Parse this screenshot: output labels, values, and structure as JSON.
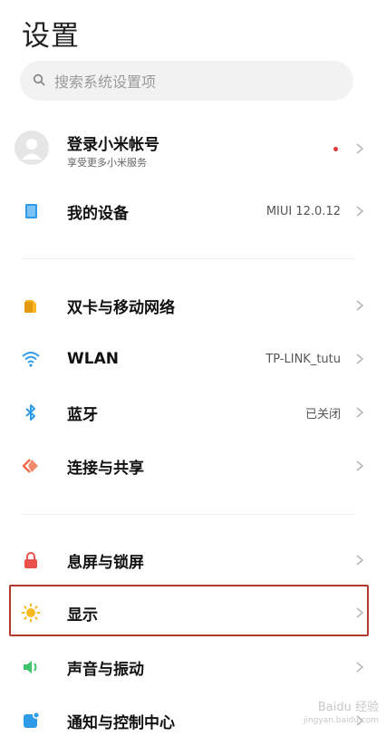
{
  "header": {
    "title": "设置"
  },
  "search": {
    "placeholder": "搜索系统设置项",
    "icon": "search-icon"
  },
  "account": {
    "title": "登录小米帐号",
    "subtitle": "享受更多小米服务",
    "notification_color": "#e53935"
  },
  "sections": [
    {
      "items": [
        {
          "label": "我的设备",
          "value": "MIUI 12.0.12",
          "icon": "device-icon"
        }
      ]
    },
    {
      "items": [
        {
          "label": "双卡与移动网络",
          "value": "",
          "icon": "sim-icon"
        },
        {
          "label": "WLAN",
          "value": "TP-LINK_tutu",
          "icon": "wifi-icon"
        },
        {
          "label": "蓝牙",
          "value": "已关闭",
          "icon": "bluetooth-icon"
        },
        {
          "label": "连接与共享",
          "value": "",
          "icon": "share-icon"
        }
      ]
    },
    {
      "items": [
        {
          "label": "息屏与锁屏",
          "value": "",
          "icon": "lock-icon"
        },
        {
          "label": "显示",
          "value": "",
          "icon": "brightness-icon",
          "highlighted": true
        },
        {
          "label": "声音与振动",
          "value": "",
          "icon": "speaker-icon"
        },
        {
          "label": "通知与控制中心",
          "value": "",
          "icon": "notification-icon"
        }
      ]
    }
  ],
  "watermark": {
    "line1": "Baidu 经验",
    "line2": "jingyan.baidu.com"
  },
  "colors": {
    "highlight": "#b03a2e",
    "accent_blue": "#2f9ae8",
    "accent_orange": "#f7b824"
  }
}
